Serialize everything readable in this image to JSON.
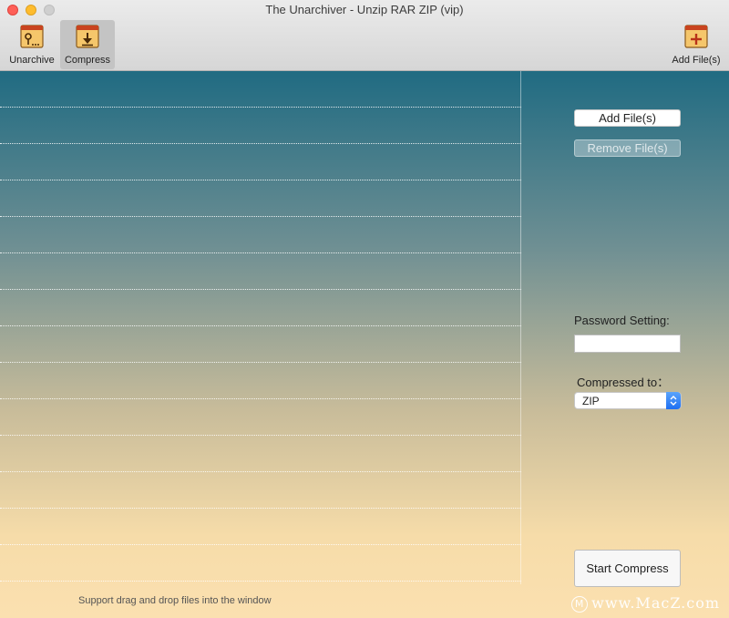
{
  "window": {
    "title": "The Unarchiver - Unzip RAR ZIP (vip)"
  },
  "toolbar": {
    "unarchive_label": "Unarchive",
    "compress_label": "Compress",
    "add_files_label": "Add File(s)"
  },
  "panel": {
    "add_files_button": "Add File(s)",
    "remove_files_button": "Remove File(s)",
    "password_label": "Password Setting:",
    "password_value": "",
    "compressed_to_label": "Compressed to：",
    "format_selected": "ZIP",
    "start_button": "Start Compress"
  },
  "footer": {
    "hint": "Support drag and drop files into the window",
    "watermark": "www.MacZ.com",
    "watermark_logo": "M"
  },
  "colors": {
    "gradient_top": "#206b82",
    "gradient_bottom": "#fbe0b0",
    "select_accent": "#1e6ff2"
  }
}
